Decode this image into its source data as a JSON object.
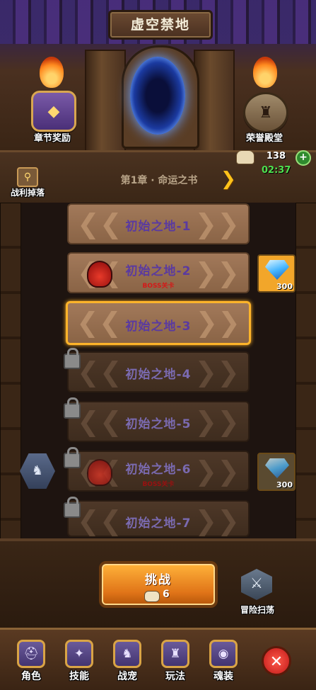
{
  "header": {
    "title": "虚空禁地",
    "chapter_reward_label": "章节奖励",
    "honor_hall_label": "荣誉殿堂"
  },
  "resources": {
    "stamina_value": "138",
    "stamina_timer": "02:37",
    "stamina_add_icon": "plus-icon"
  },
  "chapter": {
    "loot_label": "战利掉落",
    "title": "第1章 · 命运之书",
    "next_icon": "chevron-right-icon"
  },
  "stages": [
    {
      "name": "初始之地-1",
      "state": "unlocked",
      "boss": false,
      "boss_label": ""
    },
    {
      "name": "初始之地-2",
      "state": "unlocked",
      "boss": true,
      "boss_label": "BOSS关卡",
      "reward": "300"
    },
    {
      "name": "初始之地-3",
      "state": "selected",
      "boss": false,
      "boss_label": ""
    },
    {
      "name": "初始之地-4",
      "state": "locked",
      "boss": false,
      "boss_label": ""
    },
    {
      "name": "初始之地-5",
      "state": "locked",
      "boss": false,
      "boss_label": ""
    },
    {
      "name": "初始之地-6",
      "state": "locked",
      "boss": true,
      "boss_label": "BOSS关卡",
      "reward": "300"
    },
    {
      "name": "初始之地-7",
      "state": "locked",
      "boss": false,
      "boss_label": ""
    }
  ],
  "actions": {
    "challenge_label": "挑战",
    "challenge_cost": "6",
    "sweep_label": "冒险扫荡"
  },
  "nav": {
    "items": [
      {
        "label": "角色",
        "icon": "helmet-icon"
      },
      {
        "label": "技能",
        "icon": "skill-book-icon"
      },
      {
        "label": "战宠",
        "icon": "pet-icon"
      },
      {
        "label": "玩法",
        "icon": "statue-icon"
      },
      {
        "label": "魂装",
        "icon": "soul-gear-icon"
      }
    ],
    "close_icon": "close-icon"
  },
  "colors": {
    "accent_gold": "#ffb42a",
    "boss_red": "#d41818",
    "timer_green": "#4fe04f"
  }
}
